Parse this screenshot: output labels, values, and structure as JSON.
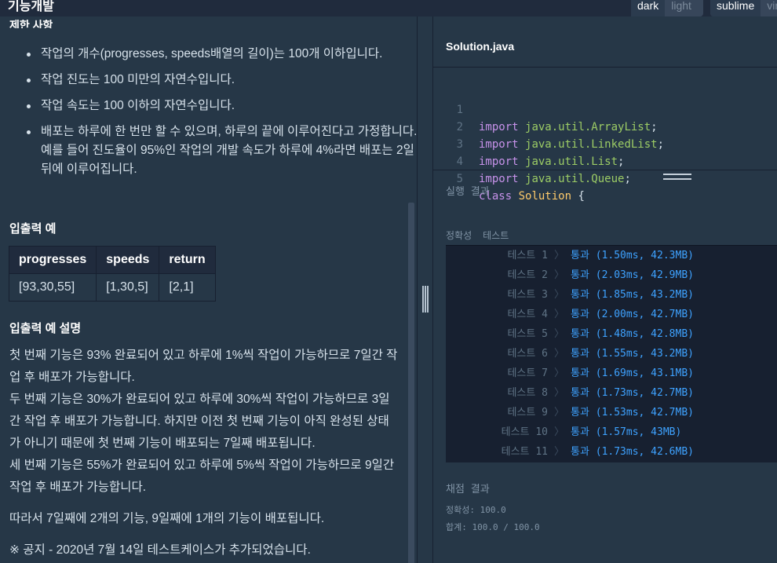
{
  "app": {
    "title": "기능개발"
  },
  "theme": {
    "dark": "dark",
    "light": "light"
  },
  "keymap": {
    "sublime": "sublime",
    "vim": "vim"
  },
  "problem": {
    "constraints_heading": "제한 사항",
    "constraints": [
      "작업의 개수(progresses, speeds배열의 길이)는 100개 이하입니다.",
      "작업 진도는 100 미만의 자연수입니다.",
      "작업 속도는 100 이하의 자연수입니다.",
      "배포는 하루에 한 번만 할 수 있으며, 하루의 끝에 이루어진다고 가정합니다. 예를 들어 진도율이 95%인 작업의 개발 속도가 하루에 4%라면 배포는 2일 뒤에 이루어집니다."
    ],
    "io_heading": "입출력 예",
    "io_table": {
      "headers": [
        "progresses",
        "speeds",
        "return"
      ],
      "rows": [
        [
          "[93,30,55]",
          "[1,30,5]",
          "[2,1]"
        ]
      ]
    },
    "explain_heading": "입출력 예 설명",
    "explain_paragraphs": [
      "첫 번째 기능은 93% 완료되어 있고 하루에 1%씩 작업이 가능하므로 7일간 작업 후 배포가 가능합니다.\n두 번째 기능은 30%가 완료되어 있고 하루에 30%씩 작업이 가능하므로 3일간 작업 후 배포가 가능합니다. 하지만 이전 첫 번째 기능이 아직 완성된 상태가 아니기 때문에 첫 번째 기능이 배포되는 7일째 배포됩니다.\n세 번째 기능은 55%가 완료되어 있고 하루에 5%씩 작업이 가능하므로 9일간 작업 후 배포가 가능합니다.",
      "따라서 7일째에 2개의 기능, 9일째에 1개의 기능이 배포됩니다."
    ],
    "notice": "※ 공지 - 2020년 7월 14일 테스트케이스가 추가되었습니다."
  },
  "editor": {
    "file_name": "Solution.java",
    "lines": [
      {
        "num": "1",
        "kw": "import",
        "pkg": "java.util.ArrayList",
        "tail": ";"
      },
      {
        "num": "2",
        "kw": "import",
        "pkg": "java.util.LinkedList",
        "tail": ";"
      },
      {
        "num": "3",
        "kw": "import",
        "pkg": "java.util.List",
        "tail": ";"
      },
      {
        "num": "4",
        "kw": "import",
        "pkg": "java.util.Queue",
        "tail": ";"
      },
      {
        "num": "5",
        "kw": "class",
        "pkg": "Solution",
        "tail": " {"
      }
    ]
  },
  "results": {
    "title": "실행 결과",
    "meta": [
      "정확성",
      "테스트"
    ],
    "rows": [
      {
        "label": "테스트 1",
        "value": "통과 (1.50ms, 42.3MB)"
      },
      {
        "label": "테스트 2",
        "value": "통과 (2.03ms, 42.9MB)"
      },
      {
        "label": "테스트 3",
        "value": "통과 (1.85ms, 43.2MB)"
      },
      {
        "label": "테스트 4",
        "value": "통과 (2.00ms, 42.7MB)"
      },
      {
        "label": "테스트 5",
        "value": "통과 (1.48ms, 42.8MB)"
      },
      {
        "label": "테스트 6",
        "value": "통과 (1.55ms, 43.2MB)"
      },
      {
        "label": "테스트 7",
        "value": "통과 (1.69ms, 43.1MB)"
      },
      {
        "label": "테스트 8",
        "value": "통과 (1.73ms, 42.7MB)"
      },
      {
        "label": "테스트 9",
        "value": "통과 (1.53ms, 42.7MB)"
      },
      {
        "label": "테스트 10",
        "value": "통과 (1.57ms, 43MB)"
      },
      {
        "label": "테스트 11",
        "value": "통과 (1.73ms, 42.6MB)"
      }
    ],
    "arrow": "〉",
    "score_title": "채점 결과",
    "accuracy": "정확성: 100.0",
    "total": "합계: 100.0 / 100.0"
  },
  "colors": {
    "background": "#263747",
    "header": "#202b3d",
    "result_box": "#172030",
    "pass": "#3ea2ff"
  }
}
